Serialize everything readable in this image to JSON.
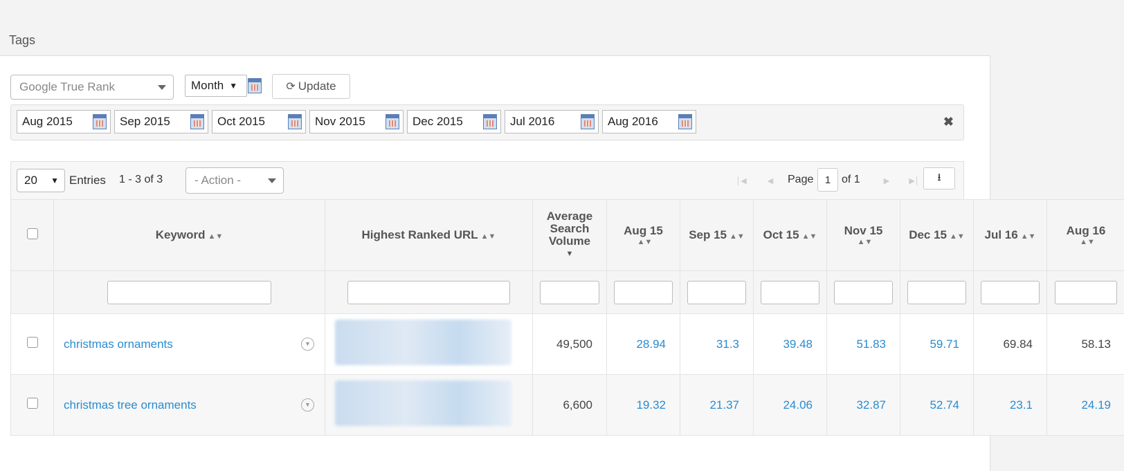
{
  "section": {
    "title": "Tags"
  },
  "controls": {
    "rank_select": "Google True Rank",
    "period_select": "Month",
    "update_label": "Update"
  },
  "dates": [
    "Aug 2015",
    "Sep 2015",
    "Oct 2015",
    "Nov 2015",
    "Dec 2015",
    "Jul 2016",
    "Aug 2016"
  ],
  "toolbar": {
    "page_size": "20",
    "entries_label": "Entries",
    "range_label": "1 - 3 of 3",
    "action_select": "- Action -",
    "page_label": "Page",
    "page_value": "1",
    "of_label": "of 1"
  },
  "table": {
    "headers": {
      "keyword": "Keyword",
      "url": "Highest Ranked URL",
      "volume_line1": "Average",
      "volume_line2": "Search",
      "volume_line3": "Volume",
      "months": [
        "Aug 15",
        "Sep 15",
        "Oct 15",
        "Nov 15",
        "Dec 15",
        "Jul 16",
        "Aug 16"
      ]
    },
    "rows": [
      {
        "keyword": "christmas ornaments",
        "volume": "49,500",
        "ranks": [
          "28.94",
          "31.3",
          "39.48",
          "51.83",
          "59.71",
          "69.84",
          "58.13"
        ],
        "rank_linked": [
          true,
          true,
          true,
          true,
          true,
          false,
          false
        ]
      },
      {
        "keyword": "christmas tree ornaments",
        "volume": "6,600",
        "ranks": [
          "19.32",
          "21.37",
          "24.06",
          "32.87",
          "52.74",
          "23.1",
          "24.19"
        ],
        "rank_linked": [
          true,
          true,
          true,
          true,
          true,
          true,
          true
        ]
      }
    ]
  }
}
